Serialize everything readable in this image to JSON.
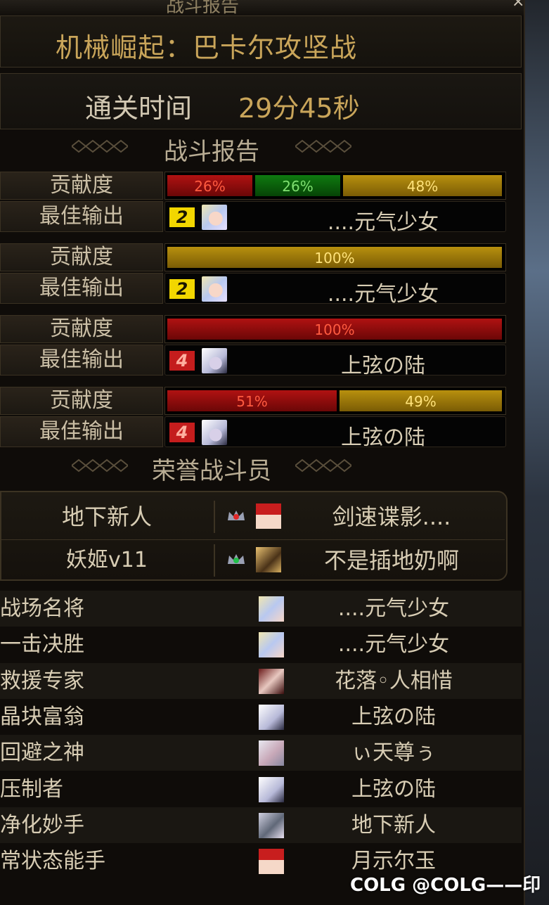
{
  "window": {
    "title_partial": "战斗报告",
    "close_glyph": "×"
  },
  "dungeon_title": "机械崛起：巴卡尔攻坚战",
  "clear_time": {
    "label": "通关时间",
    "value": "29分45秒"
  },
  "sections": {
    "battle_report": "战斗报告",
    "honor_fighters": "荣誉战斗员"
  },
  "report_groups": [
    {
      "contrib_label": "贡献度",
      "segments": [
        {
          "pct": "26%",
          "color": "red",
          "share": 26
        },
        {
          "pct": "26%",
          "color": "green",
          "share": 26
        },
        {
          "pct": "48%",
          "color": "gold",
          "share": 48
        }
      ],
      "best_label": "最佳输出",
      "badge": "2",
      "badge_color": "yellow",
      "avatar": "blonde-girl-avatar",
      "player": "....元气少女"
    },
    {
      "contrib_label": "贡献度",
      "segments": [
        {
          "pct": "100%",
          "color": "gold",
          "share": 100
        }
      ],
      "best_label": "最佳输出",
      "badge": "2",
      "badge_color": "yellow",
      "avatar": "blonde-girl-avatar",
      "player": "....元气少女"
    },
    {
      "contrib_label": "贡献度",
      "segments": [
        {
          "pct": "100%",
          "color": "red",
          "share": 100
        }
      ],
      "best_label": "最佳输出",
      "badge": "4",
      "badge_color": "red",
      "avatar": "white-hair-avatar",
      "player": "上弦の陆"
    },
    {
      "contrib_label": "贡献度",
      "segments": [
        {
          "pct": "51%",
          "color": "red",
          "share": 51
        },
        {
          "pct": "49%",
          "color": "gold",
          "share": 49
        }
      ],
      "best_label": "最佳输出",
      "badge": "4",
      "badge_color": "red",
      "avatar": "white-hair-avatar",
      "player": "上弦の陆"
    }
  ],
  "honor": [
    {
      "left": "地下新人",
      "icon": "red-gem-crown-icon",
      "avatar": "red-avatar",
      "right": "剑速谍影...."
    },
    {
      "left": "妖姬v11",
      "icon": "green-gem-crown-icon",
      "avatar": "gold-avatar",
      "right": "不是插地奶啊"
    }
  ],
  "awards": [
    {
      "title": "战场名将",
      "avatar": "blonde-girl-avatar",
      "player": "....元气少女"
    },
    {
      "title": "一击决胜",
      "avatar": "blonde-girl-avatar",
      "player": "....元气少女"
    },
    {
      "title": "救援专家",
      "avatar": "dark-red-avatar",
      "player": "花落◦人相惜"
    },
    {
      "title": "晶块富翁",
      "avatar": "white-hair-avatar",
      "player": "上弦の陆"
    },
    {
      "title": "回避之神",
      "avatar": "silver-avatar",
      "player": "ぃ天尊ぅ"
    },
    {
      "title": "压制者",
      "avatar": "white-hair-avatar",
      "player": "上弦の陆"
    },
    {
      "title": "净化妙手",
      "avatar": "grey-avatar",
      "player": "地下新人"
    },
    {
      "title": "常状态能手",
      "avatar": "red-avatar",
      "player": "月示尔玉"
    }
  ],
  "watermark": "COLG @COLG——印"
}
